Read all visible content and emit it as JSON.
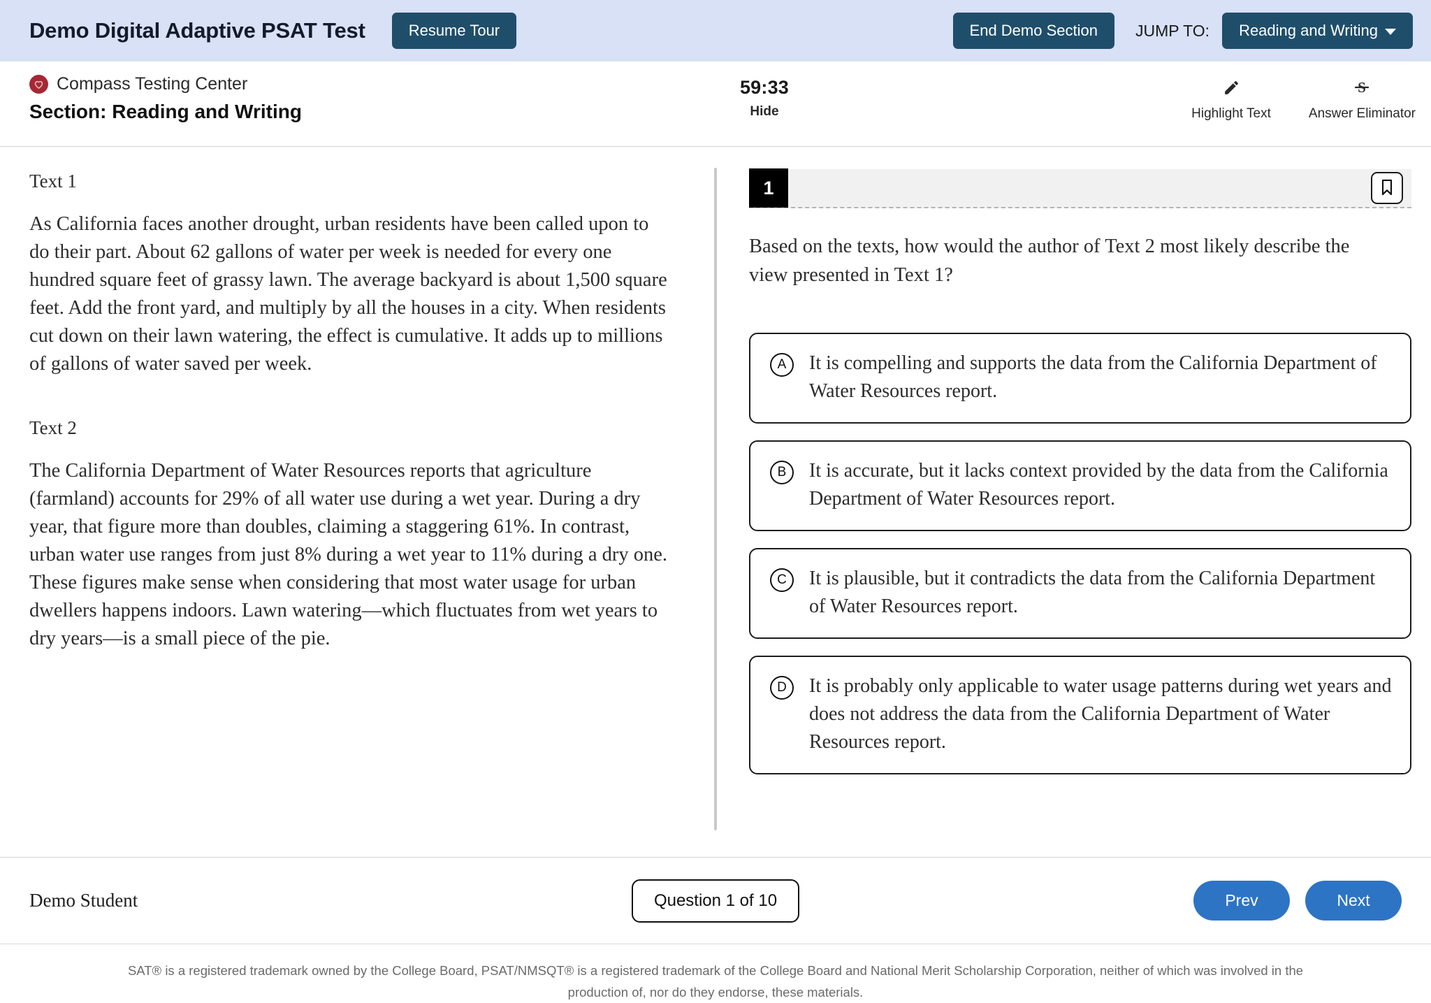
{
  "topbar": {
    "app_title": "Demo Digital Adaptive PSAT Test",
    "resume_tour_label": "Resume Tour",
    "end_section_label": "End Demo Section",
    "jump_to_label": "JUMP TO:",
    "jump_to_value": "Reading and Writing",
    "background_color": "#d8e1f5",
    "button_color": "#1f4e6b"
  },
  "subheader": {
    "center_name": "Compass Testing Center",
    "logo_icon": "compass-heart-icon",
    "logo_color": "#a52834",
    "section_label": "Section: Reading and Writing",
    "timer": "59:33",
    "hide_label": "Hide",
    "tools": [
      {
        "label": "Highlight Text",
        "icon": "pencil-icon"
      },
      {
        "label": "Answer Eliminator",
        "icon": "strikethrough-s-icon"
      }
    ]
  },
  "passage": {
    "text1_label": "Text 1",
    "text1_body": "As California faces another drought, urban residents have been called upon to do their part. About 62 gallons of water per week is needed for every one hundred square feet of grassy lawn. The average backyard is about 1,500 square feet. Add the front yard, and multiply by all the houses in a city. When residents cut down on their lawn watering, the effect is cumulative. It adds up to millions of gallons of water saved per week.",
    "text2_label": "Text 2",
    "text2_body": "The California Department of Water Resources reports that agriculture (farmland) accounts for 29% of all water use during a wet year. During a dry year, that figure more than doubles, claiming a staggering 61%. In contrast, urban water use ranges from just 8% during a wet year to 11% during a dry one. These figures make sense when considering that most water usage for urban dwellers happens indoors. Lawn watering—which fluctuates from wet years to dry years—is a small piece of the pie."
  },
  "question": {
    "number": "1",
    "bookmark_icon": "bookmark-icon",
    "prompt": "Based on the texts, how would the author of Text 2 most likely describe the view presented in Text 1?",
    "choices": [
      {
        "letter": "A",
        "text": "It is compelling and supports the data from the California Department of Water Resources report."
      },
      {
        "letter": "B",
        "text": "It is accurate, but it lacks context provided by the data from the California Department of Water Resources report."
      },
      {
        "letter": "C",
        "text": "It is plausible, but it contradicts the data from the California Department of Water Resources report."
      },
      {
        "letter": "D",
        "text": "It is probably only applicable to water usage patterns during wet years and does not address the data from the California Department of Water Resources report."
      }
    ]
  },
  "footer": {
    "student_name": "Demo Student",
    "question_counter": "Question 1 of 10",
    "prev_label": "Prev",
    "next_label": "Next",
    "button_color": "#2d74c4",
    "disclaimer": "SAT® is a registered trademark owned by the College Board, PSAT/NMSQT® is a registered trademark of the College Board and National Merit Scholarship Corporation, neither of which was involved in the production of, nor do they endorse, these materials."
  }
}
